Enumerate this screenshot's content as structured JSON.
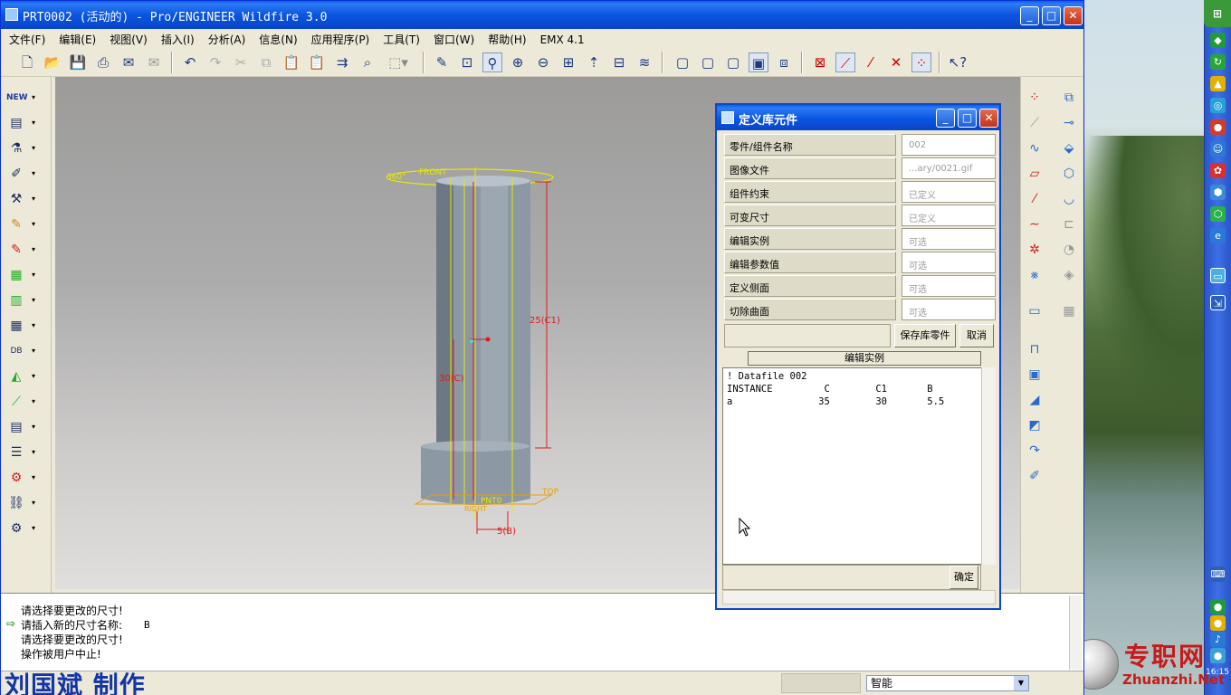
{
  "window": {
    "title": "PRT0002 (活动的) - Pro/ENGINEER Wildfire 3.0",
    "controls": {
      "minimize": "_",
      "maximize": "□",
      "close": "✕"
    }
  },
  "menubar": {
    "items": [
      "文件(F)",
      "编辑(E)",
      "视图(V)",
      "插入(I)",
      "分析(A)",
      "信息(N)",
      "应用程序(P)",
      "工具(T)",
      "窗口(W)",
      "帮助(H)",
      "EMX 4.1"
    ]
  },
  "toolbar": {
    "icons": [
      "new-icon",
      "open-icon",
      "save-icon",
      "print-icon",
      "send-icon",
      "send-mail-icon",
      "undo-icon",
      "redo-icon",
      "cut-icon",
      "copy-icon",
      "paste-icon",
      "paste-special-icon",
      "regenerate-icon",
      "find-icon",
      "select-box-icon",
      "repaint-icon",
      "orient-icon",
      "spin-center-icon",
      "zoom-in-icon",
      "zoom-out-icon",
      "refit-icon",
      "reorient-icon",
      "named-view-icon",
      "layers-icon",
      "wireframe-icon",
      "hidden-line-icon",
      "no-hidden-icon",
      "shading-icon",
      "saved-views-icon",
      "datum-plane-icon",
      "datum-axis-icon",
      "datum-point-icon",
      "coord-sys-icon",
      "context-help-icon"
    ]
  },
  "model": {
    "labels": {
      "front": "FRONT",
      "angle": "360°",
      "dim_c1": "25(C1)",
      "dim_c": "30(C)",
      "dim_b": "5(B)",
      "top": "TOP",
      "pnt0": "PNT0",
      "right": "RIGHT"
    }
  },
  "messages": {
    "lines": [
      "请选择要更改的尺寸!",
      "请插入新的尺寸名称:",
      "请选择要更改的尺寸!",
      "操作被用户中止!"
    ],
    "input_value": "B"
  },
  "statusbar": {
    "author": "刘国斌 制作",
    "filter": "智能"
  },
  "dialog": {
    "title": "定义库元件",
    "rows": [
      {
        "label": "零件/组件名称",
        "value": "002"
      },
      {
        "label": "图像文件",
        "value": "...ary/0021.gif"
      },
      {
        "label": "组件约束",
        "value": "已定义"
      },
      {
        "label": "可变尺寸",
        "value": "已定义"
      },
      {
        "label": "编辑实例",
        "value": "可选"
      },
      {
        "label": "编辑参数值",
        "value": "可选"
      },
      {
        "label": "定义侧面",
        "value": "可选"
      },
      {
        "label": "切除曲面",
        "value": "可选"
      }
    ],
    "save_button": "保存库零件",
    "cancel_button": "取消",
    "subtab": "编辑实例",
    "editor_text": "! Datafile 002\nINSTANCE         C        C1       B\na               35        30       5.5",
    "ok_button": "确定"
  },
  "desktop": {
    "watermark_cn": "专职网",
    "watermark_en": "Zhuanzhi.Net",
    "clock": "16:15"
  },
  "colors": {
    "titlebar": "#0a55e0",
    "model_lines": "#e8e800",
    "dimension": "#e01a1a",
    "author": "#1235a8",
    "watermark": "#c81a1a"
  }
}
